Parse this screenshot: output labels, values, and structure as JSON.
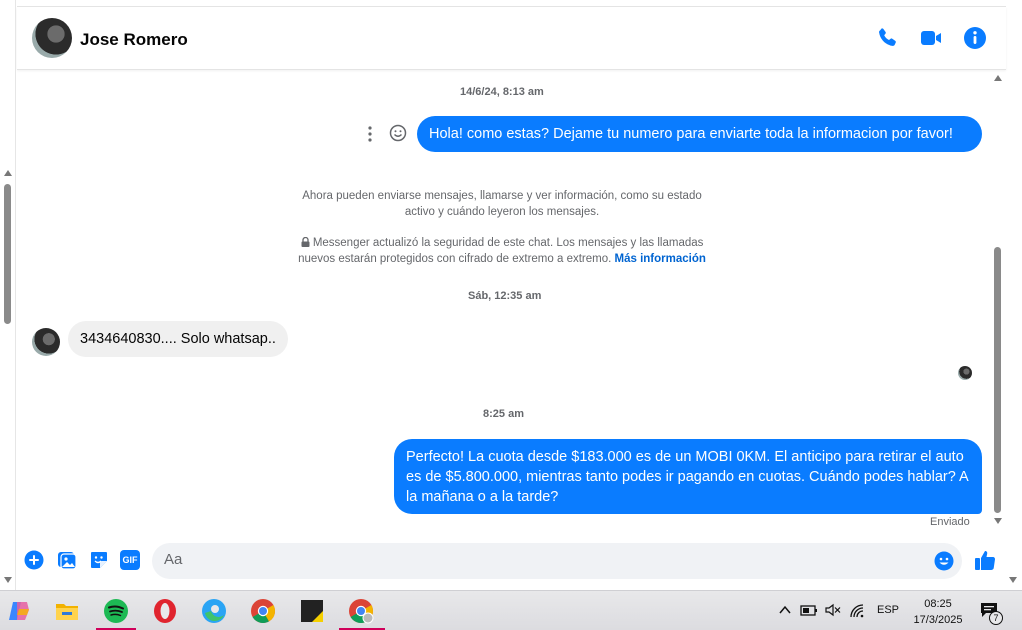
{
  "contact": {
    "name": "Jose Romero"
  },
  "header_icons": [
    "phone-icon",
    "video-icon",
    "info-icon"
  ],
  "messages": {
    "ts1": "14/6/24, 8:13 am",
    "out1": "Hola! como estas? Dejame tu numero para enviarte toda la informacion por favor!",
    "system1_line1": "Ahora pueden enviarse mensajes, llamarse y ver información, como su estado",
    "system1_line2": "activo y cuándo leyeron los mensajes.",
    "system2_line1": "Messenger actualizó la seguridad de este chat. Los mensajes y las llamadas",
    "system2_line2": "nuevos estarán protegidos con cifrado de extremo a extremo.",
    "system2_link": "Más información",
    "ts2": "Sáb, 12:35 am",
    "in1": "3434640830.... Solo whatsap..",
    "ts3": "8:25 am",
    "out2": "Perfecto! La cuota desde $183.000 es de un MOBI 0KM. El anticipo para retirar el auto es de $5.800.000, mientras tanto podes ir pagando en cuotas. Cuándo podes hablar? A la mañana o a la tarde?",
    "status": "Enviado"
  },
  "composer": {
    "placeholder": "Aa",
    "gif_label": "GIF"
  },
  "taskbar": {
    "lang": "ESP",
    "time": "08:25",
    "date": "17/3/2025",
    "notif_count": "7"
  },
  "colors": {
    "accent": "#0a7cff",
    "link": "#0064d1"
  }
}
